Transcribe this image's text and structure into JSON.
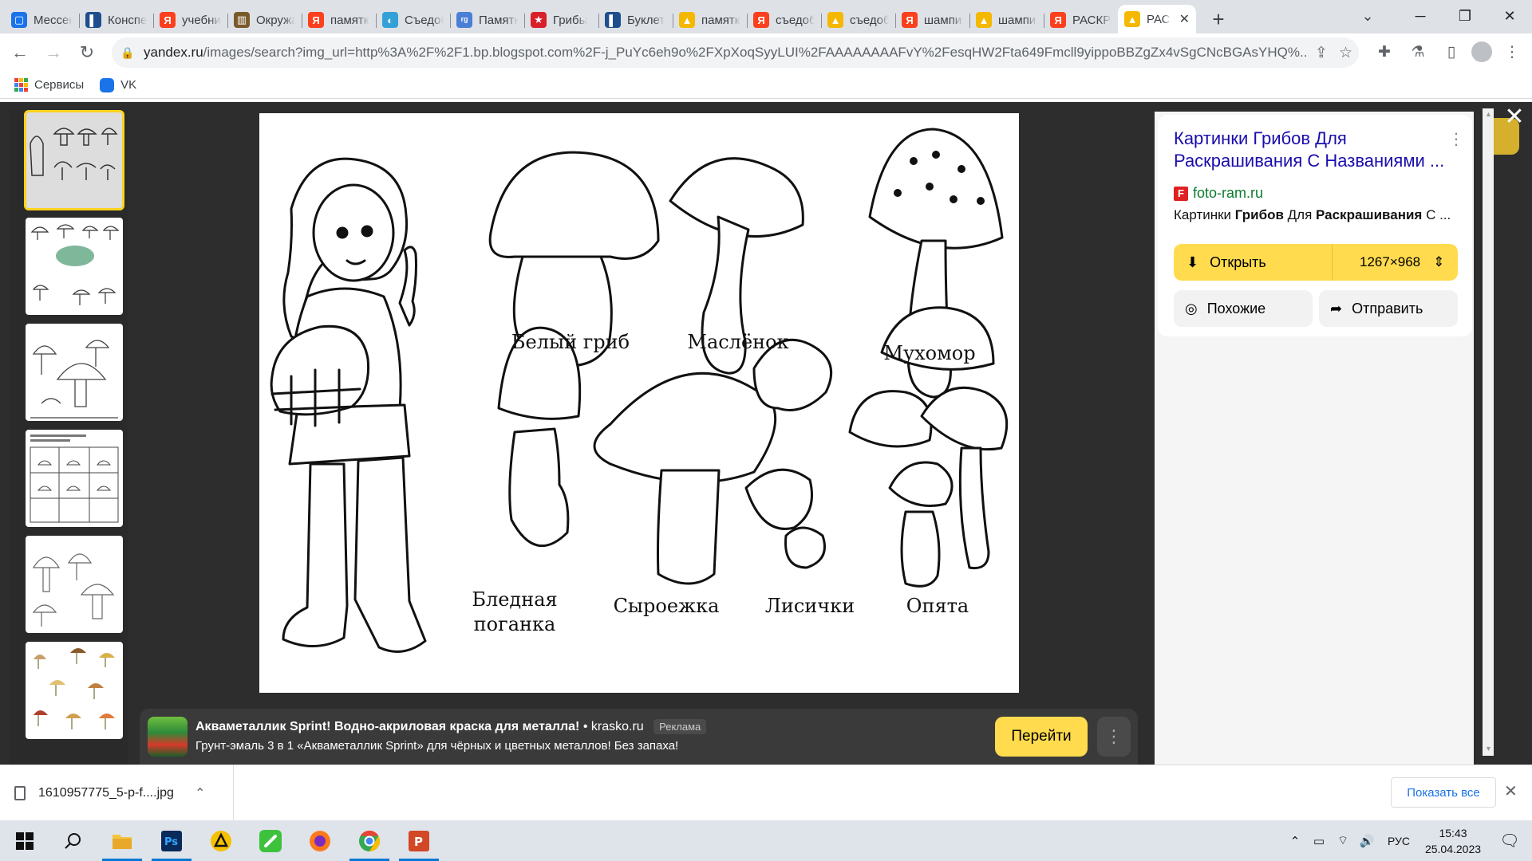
{
  "tabs": [
    {
      "title": "Мессенджер",
      "color": "#1a73e8",
      "glyph": "▢"
    },
    {
      "title": "Конспект",
      "color": "#1f4e8c",
      "glyph": "▌"
    },
    {
      "title": "учебник",
      "color": "#fc3f1d",
      "glyph": "Я"
    },
    {
      "title": "Окружающий",
      "color": "#7a5a2a",
      "glyph": "▥"
    },
    {
      "title": "памятка",
      "color": "#fc3f1d",
      "glyph": "Я"
    },
    {
      "title": "Съедобные",
      "color": "#34a0d8",
      "glyph": "◐"
    },
    {
      "title": "Памятка",
      "color": "#4a7fd6",
      "glyph": "ʳᵍ"
    },
    {
      "title": "Грибы",
      "color": "#d8202a",
      "glyph": "★"
    },
    {
      "title": "Буклет",
      "color": "#1f4e8c",
      "glyph": "▌"
    },
    {
      "title": "памятка",
      "color": "#f5b800",
      "glyph": "▲"
    },
    {
      "title": "съедобные",
      "color": "#fc3f1d",
      "glyph": "Я"
    },
    {
      "title": "съедобные",
      "color": "#f5b800",
      "glyph": "▲"
    },
    {
      "title": "шампиньоны",
      "color": "#fc3f1d",
      "glyph": "Я"
    },
    {
      "title": "шампиньоны",
      "color": "#f5b800",
      "glyph": "▲"
    },
    {
      "title": "РАСКРАСКИ",
      "color": "#fc3f1d",
      "glyph": "Я"
    },
    {
      "title": "РАС",
      "color": "#f5b800",
      "glyph": "▲",
      "active": true
    }
  ],
  "toolbar": {
    "url_host": "yandex.ru",
    "url_rest": "/images/search?img_url=http%3A%2F%2F1.bp.blogspot.com%2F-j_PuYc6eh9o%2FXpXoqSyyLUI%2FAAAAAAAAFvY%2FesqHW2Fta649Fmcll9yippoBBZgZx4vSgCNcBGAsYHQ%..."
  },
  "bookmarks": [
    {
      "label": "Сервисы"
    },
    {
      "label": "VK"
    }
  ],
  "image_captions": {
    "belyi": "Белый гриб",
    "maslenok": "Маслёнок",
    "muhomor": "Мухомор",
    "poganka": "Бледная поганка",
    "syroezhka": "Сыроежка",
    "lisichki": "Лисички",
    "opyata": "Опята"
  },
  "ad": {
    "title": "Акваметаллик Sprint! Водно-акриловая краска для металла!",
    "source": "• krasko.ru",
    "tag": "Реклама",
    "text": "Грунт-эмаль 3 в 1 «Акваметаллик Sprint» для чёрных и цветных металлов! Без запаха!",
    "go_label": "Перейти"
  },
  "side": {
    "title": "Картинки Грибов Для Раскрашивания С Названиями ...",
    "site": "foto-ram.ru",
    "snippet_parts": [
      "Картинки ",
      "Грибов",
      " Для ",
      "Раскрашивания",
      " С ..."
    ],
    "open_label": "Открыть",
    "size": "1267×968",
    "similar_label": "Похожие",
    "share_label": "Отправить"
  },
  "download": {
    "filename": "1610957775_5-p-f....jpg",
    "show_all": "Показать все"
  },
  "taskbar": {
    "lang": "РУС",
    "time": "15:43",
    "date": "25.04.2023"
  }
}
